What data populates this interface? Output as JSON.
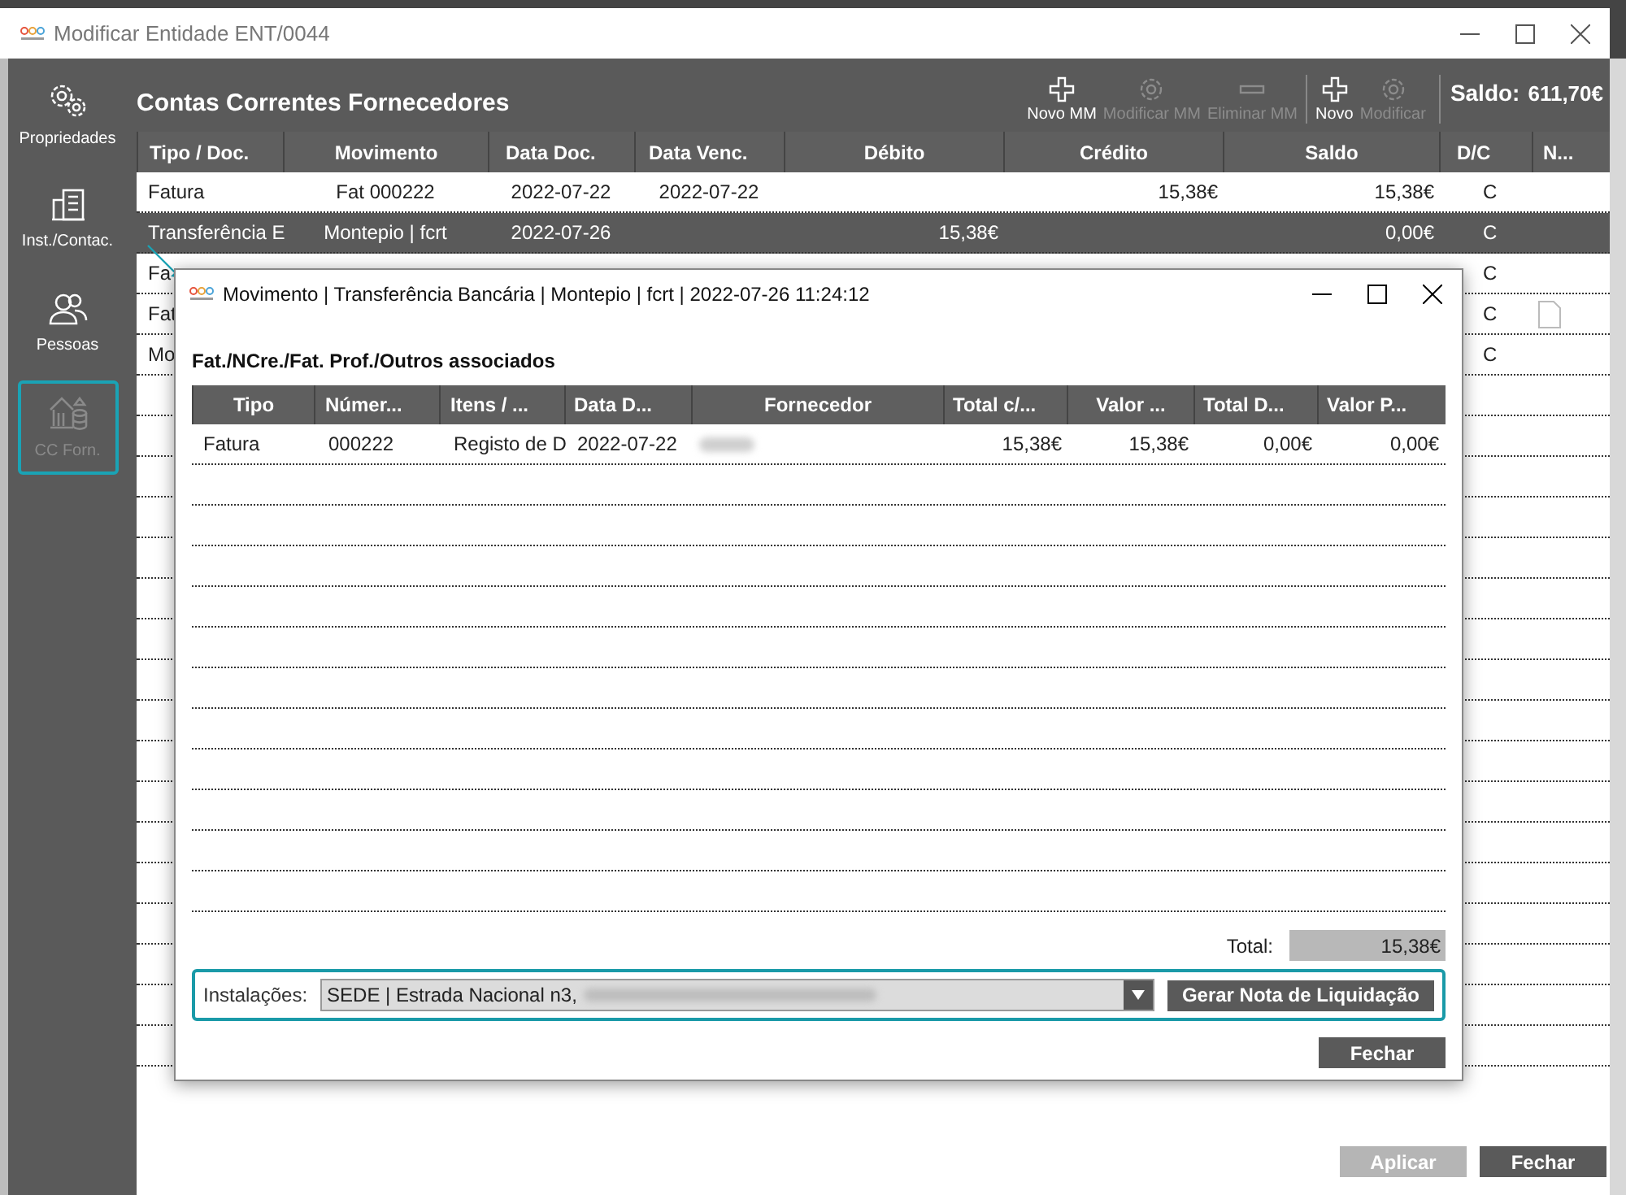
{
  "window": {
    "title": "Modificar Entidade ENT/0044"
  },
  "sidebar": {
    "items": [
      {
        "label": "Propriedades",
        "kind": "gears",
        "selected": false
      },
      {
        "label": "Inst./Contac.",
        "kind": "building",
        "selected": false
      },
      {
        "label": "Pessoas",
        "kind": "people",
        "selected": false
      },
      {
        "label": "CC Forn.",
        "kind": "bank",
        "selected": true
      }
    ]
  },
  "main": {
    "title": "Contas Correntes Fornecedores",
    "toolbar": [
      {
        "label": "Novo MM",
        "kind": "plus",
        "disabled": false
      },
      {
        "label": "Modificar MM",
        "kind": "gear",
        "disabled": true
      },
      {
        "label": "Eliminar MM",
        "kind": "minus",
        "disabled": true
      },
      {
        "label": "Novo",
        "kind": "plus",
        "disabled": false,
        "separator_before": true
      },
      {
        "label": "Modificar",
        "kind": "gear",
        "disabled": true
      }
    ],
    "saldo_label": "Saldo:",
    "saldo": "611,70€",
    "table": {
      "columns": [
        "Tipo / Doc.",
        "Movimento",
        "Data Doc.",
        "Data Venc.",
        "Débito",
        "Crédito",
        "Saldo",
        "D/C",
        "N..."
      ],
      "rows": [
        {
          "cells": [
            "Fatura",
            "Fat 000222",
            "2022-07-22",
            "2022-07-22",
            null,
            "15,38€",
            "15,38€",
            "C",
            null
          ],
          "selected": false,
          "attachment": false
        },
        {
          "cells": [
            "Transferência E",
            "Montepio | fcrt",
            "2022-07-26",
            null,
            "15,38€",
            null,
            "0,00€",
            "C",
            null
          ],
          "selected": true,
          "attachment": false
        },
        {
          "cells": [
            "Fa",
            null,
            null,
            null,
            null,
            null,
            null,
            "C",
            null
          ],
          "selected": false,
          "attachment": false
        },
        {
          "cells": [
            "Fat",
            null,
            null,
            null,
            null,
            null,
            null,
            "C",
            null
          ],
          "selected": false,
          "attachment": true
        },
        {
          "cells": [
            "Mo",
            null,
            null,
            null,
            null,
            null,
            null,
            "C",
            null
          ],
          "selected": false,
          "attachment": false
        }
      ]
    }
  },
  "buttons": [
    {
      "label": "Aplicar",
      "disabled": true
    },
    {
      "label": "Fechar",
      "disabled": false
    }
  ],
  "dialog": {
    "title": "Movimento | Transferência Bancária | Montepio | fcrt | 2022-07-26 11:24:12",
    "section_title": "Fat./NCre./Fat. Prof./Outros associados",
    "table": {
      "columns": [
        "Tipo",
        "Númer...",
        "Itens / ...",
        "Data D...",
        "Fornecedor",
        "Total c/...",
        "Valor ...",
        "Total D...",
        "Valor P..."
      ],
      "rows": [
        {
          "cells": [
            "Fatura",
            "000222",
            "Registo de D",
            "2022-07-22",
            null,
            "15,38€",
            "15,38€",
            "0,00€",
            "0,00€"
          ]
        }
      ]
    },
    "total_label": "Total:",
    "total": "15,38€",
    "installations_label": "Instalações:",
    "installation": "SEDE | Estrada Nacional n3,",
    "action_button": "Gerar Nota de Liquidação",
    "close_button": "Fechar"
  }
}
